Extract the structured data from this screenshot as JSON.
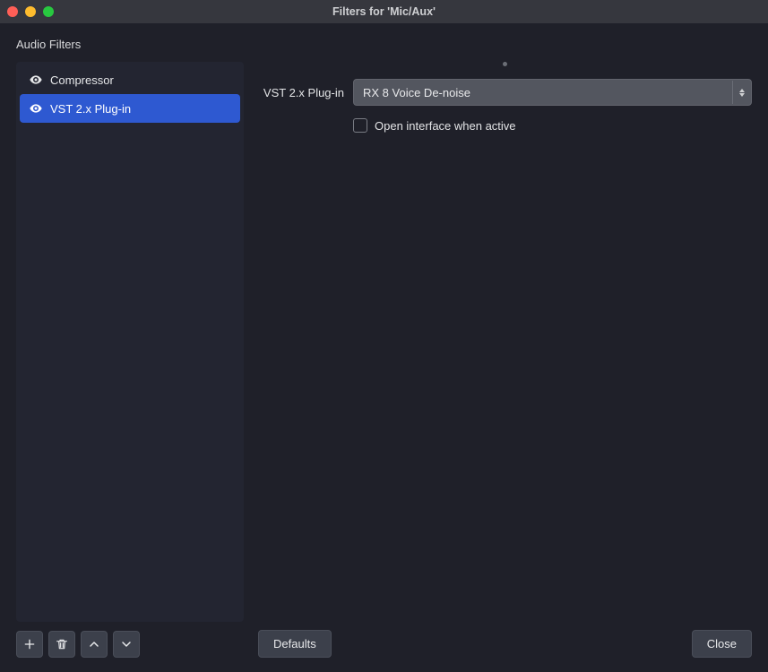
{
  "window": {
    "title": "Filters for 'Mic/Aux'"
  },
  "section": {
    "audio_filters_label": "Audio Filters"
  },
  "filters": {
    "items": [
      {
        "label": "Compressor",
        "selected": false,
        "visible": true
      },
      {
        "label": "VST 2.x Plug-in",
        "selected": true,
        "visible": true
      }
    ]
  },
  "details": {
    "plugin_label": "VST 2.x Plug-in",
    "plugin_selected": "RX 8 Voice De-noise",
    "open_interface_label": "Open interface when active",
    "open_interface_checked": false
  },
  "buttons": {
    "defaults": "Defaults",
    "close": "Close"
  }
}
